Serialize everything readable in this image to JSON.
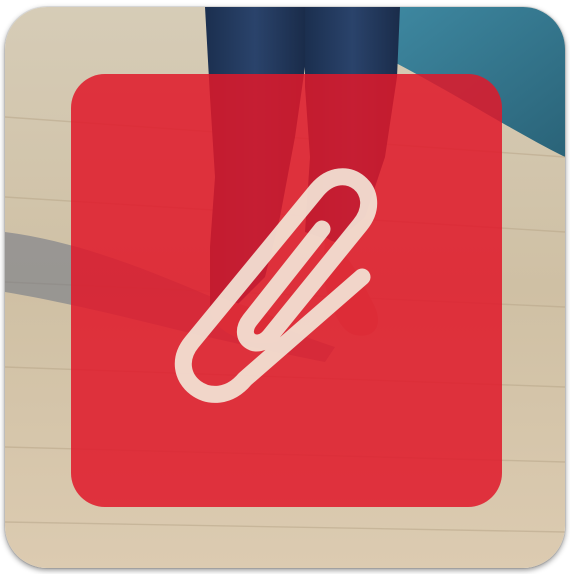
{
  "app_icon": {
    "icon": "paperclip-icon",
    "photo": "person-walking-on-wooden-boardwalk",
    "colors": {
      "overlay": "#e0182a",
      "clip": "#f2e4d6",
      "jeans": "#1f3456",
      "boardwalk": "#d9c9ad",
      "water": "#2f6f86"
    }
  }
}
